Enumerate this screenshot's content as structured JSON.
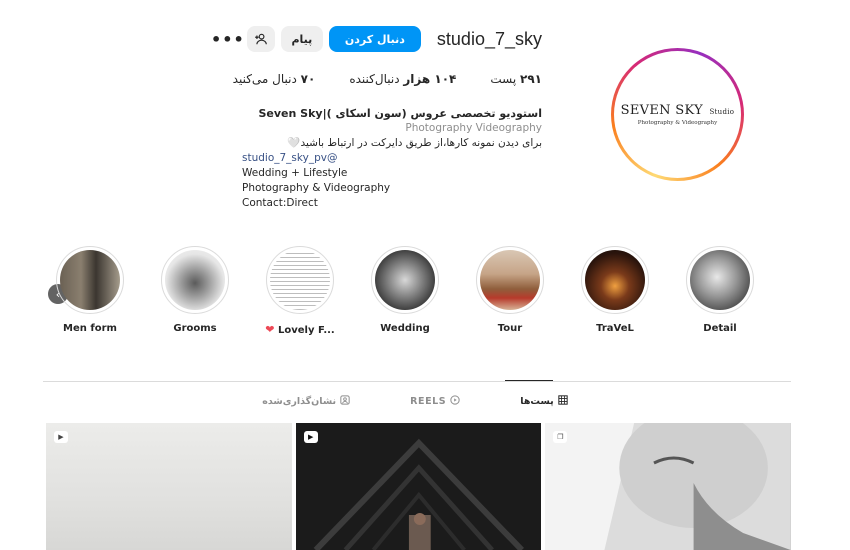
{
  "profile": {
    "username": "studio_7_sky",
    "follow_label": "دنبال کردن",
    "message_label": "پیام",
    "logo": {
      "main": "SEVEN SKY",
      "small": "Studio",
      "sub": "Photography & Videography"
    }
  },
  "stats": {
    "posts_value": "۲۹۱",
    "posts_label": "پست",
    "followers_value": "۱۰۴ هزار",
    "followers_label": "دنبال‌کننده",
    "following_value": "۷۰",
    "following_label": "دنبال می‌کنید"
  },
  "bio": {
    "name": "استودیو تخصصی عروس (سون اسکای )|Seven Sky",
    "category": "Photography Videography",
    "line1": "برای دیدن نمونه کارها،از طریق دایرکت در ارتباط باشید🤍",
    "mention": "studio_7_sky_pv@",
    "line2": "Wedding + Lifestyle",
    "line3": "Photography & Videography",
    "line4": "Contact:Direct"
  },
  "highlights": [
    {
      "label": "Men form",
      "has_heart": false
    },
    {
      "label": "Grooms",
      "has_heart": false
    },
    {
      "label": "Lovely F...",
      "has_heart": true
    },
    {
      "label": "Wedding",
      "has_heart": false
    },
    {
      "label": "Tour",
      "has_heart": false
    },
    {
      "label": "TraVeL",
      "has_heart": false
    },
    {
      "label": "Detail",
      "has_heart": false
    }
  ],
  "tabs": {
    "tagged": "نشان‌گذاری‌شده",
    "reels": "REELS",
    "posts": "پست‌ها"
  },
  "colors": {
    "accent": "#0095f6",
    "text": "#262626",
    "muted": "#8e8e8e",
    "link": "#385185"
  }
}
